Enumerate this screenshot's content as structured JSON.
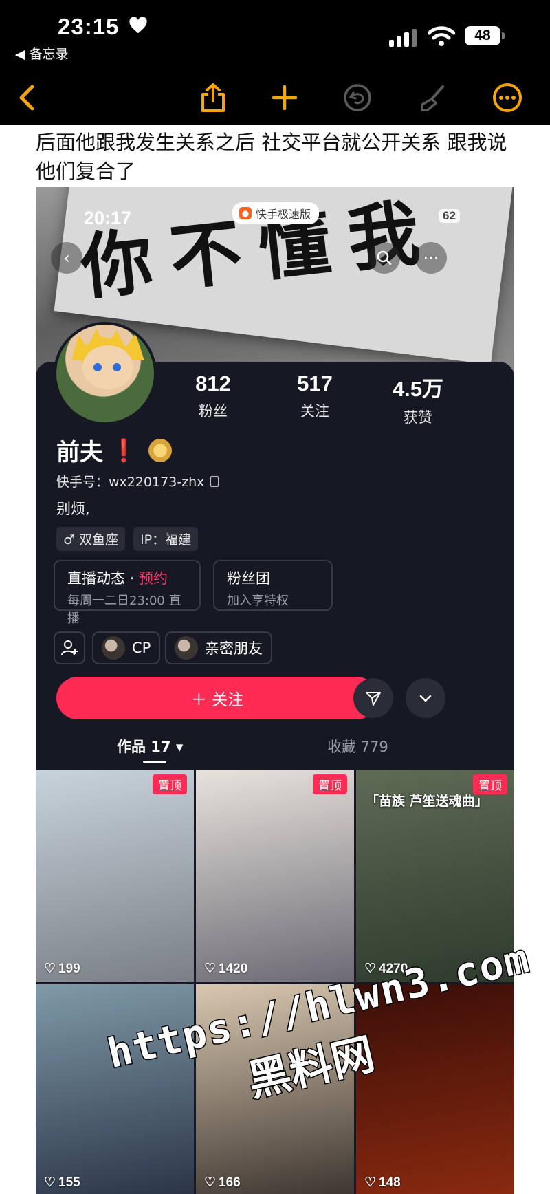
{
  "status_bar": {
    "time": "23:15",
    "back_app": "备忘录",
    "battery": "48"
  },
  "notes_toolbar": {
    "icons": [
      "back-chevron-icon",
      "share-icon",
      "add-icon",
      "undo-icon",
      "markup-brush-icon",
      "more-icon"
    ]
  },
  "note": {
    "text": "后面他跟我发生关系之后 社交平台就公开关系 跟我说他们复合了"
  },
  "embedded": {
    "status_bar": {
      "time": "20:17",
      "app_pill": "快手极速版",
      "battery": "62"
    },
    "banner_text": "你不懂我",
    "stats": [
      {
        "value": "812",
        "label": "粉丝"
      },
      {
        "value": "517",
        "label": "关注"
      },
      {
        "value": "4.5万",
        "label": "获赞"
      }
    ],
    "profile": {
      "name": "前夫",
      "mark": "❗",
      "kuaishou_id": "快手号：wx220173-zhx",
      "bio": "别烦,",
      "tags": [
        "♂ 双鱼座",
        "IP：福建"
      ]
    },
    "cards": [
      {
        "title": "直播动态 · ",
        "highlight": "预约",
        "subtitle": "每周一二日23:00 直播"
      },
      {
        "title": "粉丝团",
        "highlight": "",
        "subtitle": "加入享特权"
      }
    ],
    "chips": [
      {
        "label": "CP"
      },
      {
        "label": "亲密朋友"
      }
    ],
    "follow_label": "＋ 关注",
    "tabs": {
      "works": "作品 17 ▾",
      "favorites": "收藏 779"
    },
    "grid": [
      {
        "pinned": "置顶",
        "likes": "199",
        "caption": "",
        "colors": [
          "#c7d3dc",
          "#7b7f86"
        ]
      },
      {
        "pinned": "置顶",
        "likes": "1420",
        "caption": "",
        "colors": [
          "#e6e2dc",
          "#6d6a74"
        ]
      },
      {
        "pinned": "置顶",
        "likes": "4270",
        "caption": "「苗族 芦笙送魂曲」",
        "colors": [
          "#5f6b55",
          "#2e3a2c"
        ]
      },
      {
        "pinned": "",
        "likes": "155",
        "caption": "",
        "colors": [
          "#7f9aa8",
          "#2b3448"
        ]
      },
      {
        "pinned": "",
        "likes": "166",
        "caption": "",
        "colors": [
          "#d9c8b0",
          "#3d3530"
        ]
      },
      {
        "pinned": "",
        "likes": "148",
        "caption": "",
        "colors": [
          "#3a0e08",
          "#8a2a10"
        ]
      }
    ]
  },
  "watermark": {
    "url": "https://hlwn3.com",
    "name": "黑料网"
  }
}
